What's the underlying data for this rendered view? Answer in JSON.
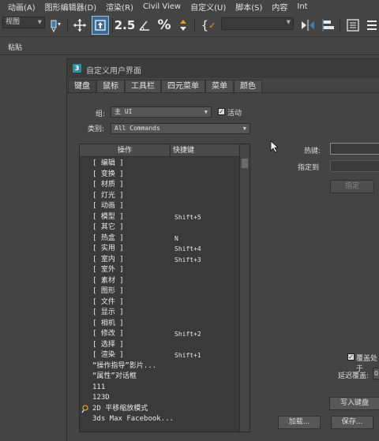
{
  "menu": [
    "动画(A)",
    "图形编辑器(D)",
    "渲染(R)",
    "Civil View",
    "自定义(U)",
    "脚本(S)",
    "内容",
    "Int"
  ],
  "toolbar": {
    "view_select": "视图",
    "snap_label": "2.5",
    "selection_set_placeholder": ""
  },
  "bar2": {
    "paste_label": "粘贴"
  },
  "dialog": {
    "title": "自定义用户界面",
    "tabs": [
      "键盘",
      "鼠标",
      "工具栏",
      "四元菜单",
      "菜单",
      "颜色"
    ],
    "active_tab": 0,
    "group_label": "组:",
    "group_value": "主 UI",
    "active_label": "活动",
    "active_checked": true,
    "category_label": "类别:",
    "category_value": "All Commands",
    "list_headers": {
      "action": "操作",
      "shortcut": "快捷键"
    },
    "rows": [
      {
        "action": "[ 编辑 ]",
        "shortcut": "",
        "icon": ""
      },
      {
        "action": "[ 变换 ]",
        "shortcut": "",
        "icon": ""
      },
      {
        "action": "[ 材质 ]",
        "shortcut": "",
        "icon": ""
      },
      {
        "action": "[ 灯光 ]",
        "shortcut": "",
        "icon": ""
      },
      {
        "action": "[ 动画 ]",
        "shortcut": "",
        "icon": ""
      },
      {
        "action": "[ 模型 ]",
        "shortcut": "Shift+5",
        "icon": ""
      },
      {
        "action": "[ 其它 ]",
        "shortcut": "",
        "icon": ""
      },
      {
        "action": "[ 热盒 ]",
        "shortcut": "N",
        "icon": ""
      },
      {
        "action": "[ 实用 ]",
        "shortcut": "Shift+4",
        "icon": ""
      },
      {
        "action": "[ 室内 ]",
        "shortcut": "Shift+3",
        "icon": ""
      },
      {
        "action": "[ 室外 ]",
        "shortcut": "",
        "icon": ""
      },
      {
        "action": "[ 素材 ]",
        "shortcut": "",
        "icon": ""
      },
      {
        "action": "[ 图形 ]",
        "shortcut": "",
        "icon": ""
      },
      {
        "action": "[ 文件 ]",
        "shortcut": "",
        "icon": ""
      },
      {
        "action": "[ 显示 ]",
        "shortcut": "",
        "icon": ""
      },
      {
        "action": "[ 相机 ]",
        "shortcut": "",
        "icon": ""
      },
      {
        "action": "[ 修改 ]",
        "shortcut": "Shift+2",
        "icon": ""
      },
      {
        "action": "[ 选择 ]",
        "shortcut": "",
        "icon": ""
      },
      {
        "action": "[ 渲染 ]",
        "shortcut": "Shift+1",
        "icon": ""
      },
      {
        "action": "“操作指导”影片...",
        "shortcut": "",
        "icon": ""
      },
      {
        "action": "“属性”对话框",
        "shortcut": "",
        "icon": ""
      },
      {
        "action": "111",
        "shortcut": "",
        "icon": ""
      },
      {
        "action": "123D",
        "shortcut": "",
        "icon": ""
      },
      {
        "action": "2D 平移缩放模式",
        "shortcut": "",
        "icon": "pan-zoom-icon"
      },
      {
        "action": "3ds Max Facebook...",
        "shortcut": "",
        "icon": ""
      }
    ],
    "hotkey_label": "热键:",
    "hotkey_value": "",
    "assigned_to_label": "指定到",
    "assigned_to_value": "",
    "assign_button": "指定",
    "override_label": "覆盖处于",
    "override_checked": true,
    "delay_override_label": "延迟覆盖:",
    "delay_override_value": "0",
    "write_keyboard_button": "写入键盘",
    "load_button": "加载...",
    "save_button": "保存..."
  },
  "colors": {
    "background": "#444444",
    "selected_tool": "#3d6b93",
    "dialog_logo": "#2f8fa0"
  }
}
